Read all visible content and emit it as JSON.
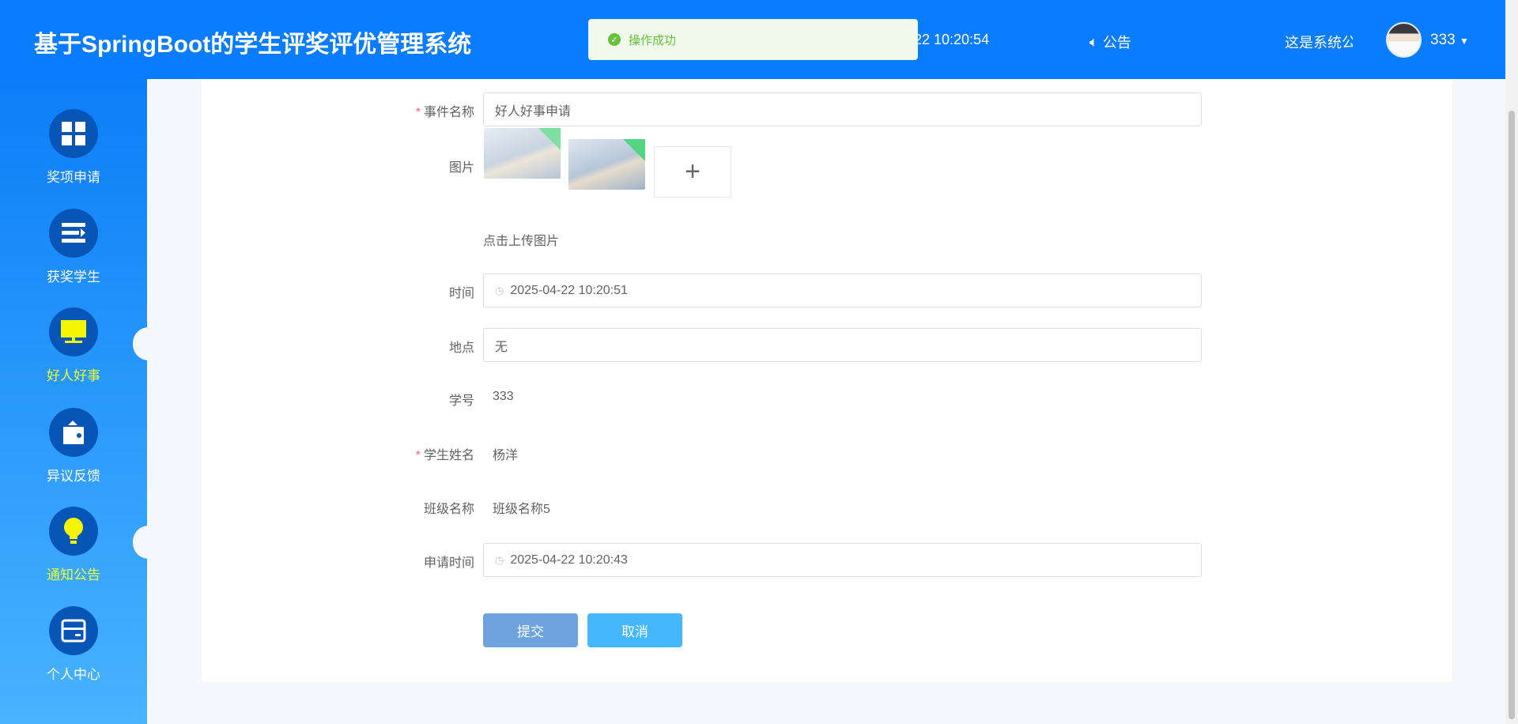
{
  "header": {
    "title": "基于SpringBoot的学生评奖评优管理系统",
    "clock": "-22 10:20:54",
    "notice_label": "公告",
    "marquee": "这是系统公",
    "username": "333"
  },
  "toast": {
    "message": "操作成功"
  },
  "sidebar": {
    "items": [
      {
        "label": "奖项申请",
        "icon": "grid-icon"
      },
      {
        "label": "获奖学生",
        "icon": "list-icon"
      },
      {
        "label": "好人好事",
        "icon": "monitor-icon",
        "active": true
      },
      {
        "label": "异议反馈",
        "icon": "wallet-icon"
      },
      {
        "label": "通知公告",
        "icon": "bulb-icon",
        "active": true
      },
      {
        "label": "个人中心",
        "icon": "card-icon"
      }
    ]
  },
  "form": {
    "event_name": {
      "label": "事件名称",
      "value": "好人好事申请"
    },
    "image": {
      "label": "图片",
      "hint": "点击上传图片",
      "add": "+"
    },
    "time": {
      "label": "时间",
      "value": "2025-04-22 10:20:51"
    },
    "place": {
      "label": "地点",
      "value": "无"
    },
    "student_id": {
      "label": "学号",
      "value": "333"
    },
    "student_name": {
      "label": "学生姓名",
      "value": "杨洋"
    },
    "class_name": {
      "label": "班级名称",
      "value": "班级名称5"
    },
    "apply_time": {
      "label": "申请时间",
      "value": "2025-04-22 10:20:43"
    },
    "submit": "提交",
    "cancel": "取消",
    "required_mark": "*"
  },
  "colors": {
    "header": "#0a7cff",
    "active_nav": "#e9ff3a",
    "submit": "#6fa3e0",
    "cancel": "#45b7ff"
  }
}
